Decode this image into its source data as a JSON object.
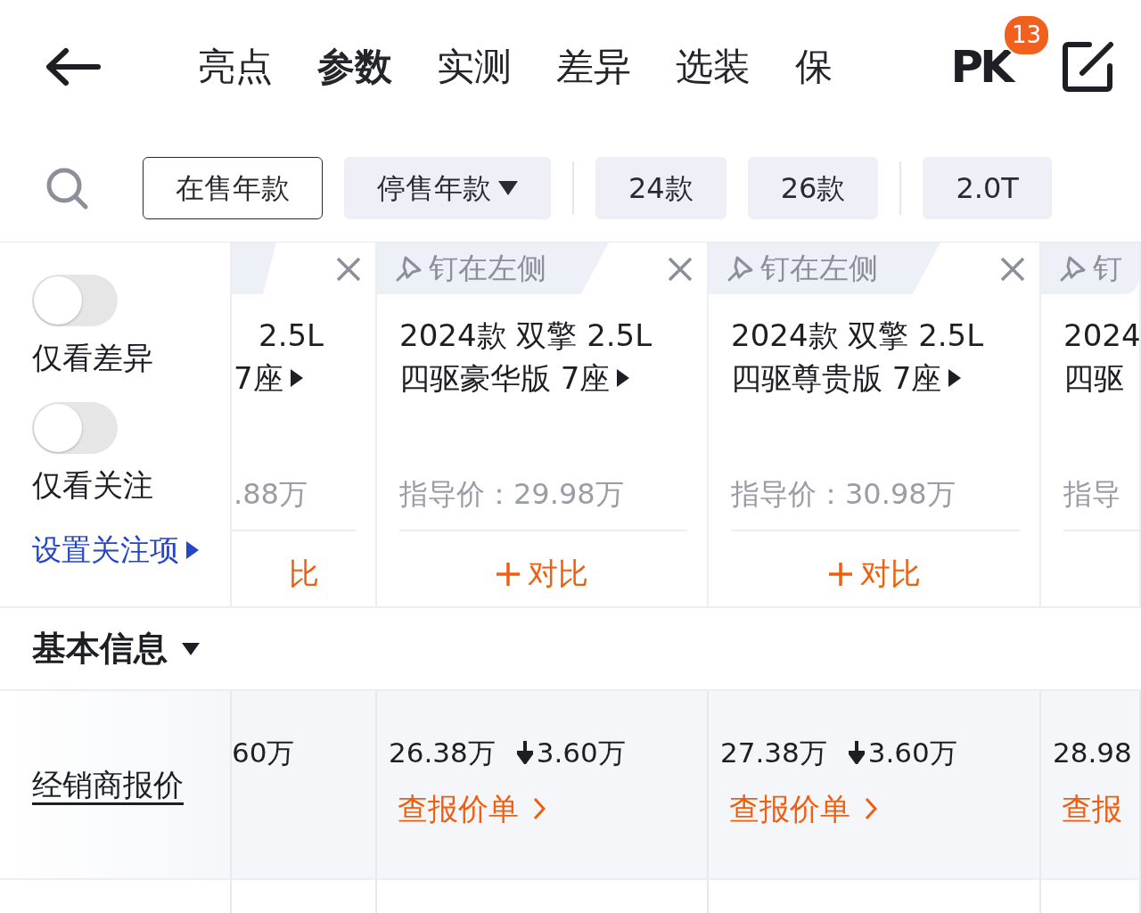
{
  "header": {
    "tabs": [
      {
        "label": "亮点",
        "selected": false
      },
      {
        "label": "参数",
        "selected": true
      },
      {
        "label": "实测",
        "selected": false
      },
      {
        "label": "差异",
        "selected": false
      },
      {
        "label": "选装",
        "selected": false
      },
      {
        "label": "保",
        "selected": false
      }
    ],
    "pk_label": "PK",
    "pk_badge": "13"
  },
  "filters": [
    {
      "label": "在售年款",
      "kind": "chip",
      "selected": true
    },
    {
      "label": "停售年款",
      "kind": "dropdown",
      "selected": false
    },
    {
      "kind": "divider"
    },
    {
      "label": "24款",
      "kind": "chip",
      "selected": false
    },
    {
      "label": "26款",
      "kind": "chip",
      "selected": false
    },
    {
      "kind": "divider"
    },
    {
      "label": "2.0T",
      "kind": "chip",
      "selected": false
    }
  ],
  "side": {
    "toggles": [
      {
        "label": "仅看差异",
        "on": false
      },
      {
        "label": "仅看关注",
        "on": false
      }
    ],
    "link": "设置关注项"
  },
  "models": [
    {
      "name_lines": [
        "2.5L",
        "7座"
      ],
      "name_arrow": true,
      "price": ".88万",
      "compare": "比",
      "compare_plus": false
    },
    {
      "pin": "钉在左侧",
      "name_lines": [
        "2024款 双擎 2.5L",
        "四驱豪华版 7座"
      ],
      "name_arrow": true,
      "price": "指导价：29.98万",
      "compare": "对比",
      "compare_plus": true
    },
    {
      "pin": "钉在左侧",
      "name_lines": [
        "2024款 双擎 2.5L",
        "四驱尊贵版 7座"
      ],
      "name_arrow": true,
      "price": "指导价：30.98万",
      "compare": "对比",
      "compare_plus": true
    },
    {
      "pin": "钉",
      "name_lines": [
        "2024",
        "四驱"
      ],
      "name_arrow": false,
      "price": "指导"
    }
  ],
  "section": {
    "title": "基本信息",
    "expanded": true
  },
  "rows": [
    {
      "label": "经销商报价",
      "cells": [
        {
          "price": "60万"
        },
        {
          "price": "26.38万",
          "drop": "3.60万",
          "link": "查报价单",
          "link_arrow": true
        },
        {
          "price": "27.38万",
          "drop": "3.60万",
          "link": "查报价单",
          "link_arrow": true
        },
        {
          "price": "28.98",
          "link": "查报",
          "link_arrow": false
        }
      ]
    }
  ]
}
